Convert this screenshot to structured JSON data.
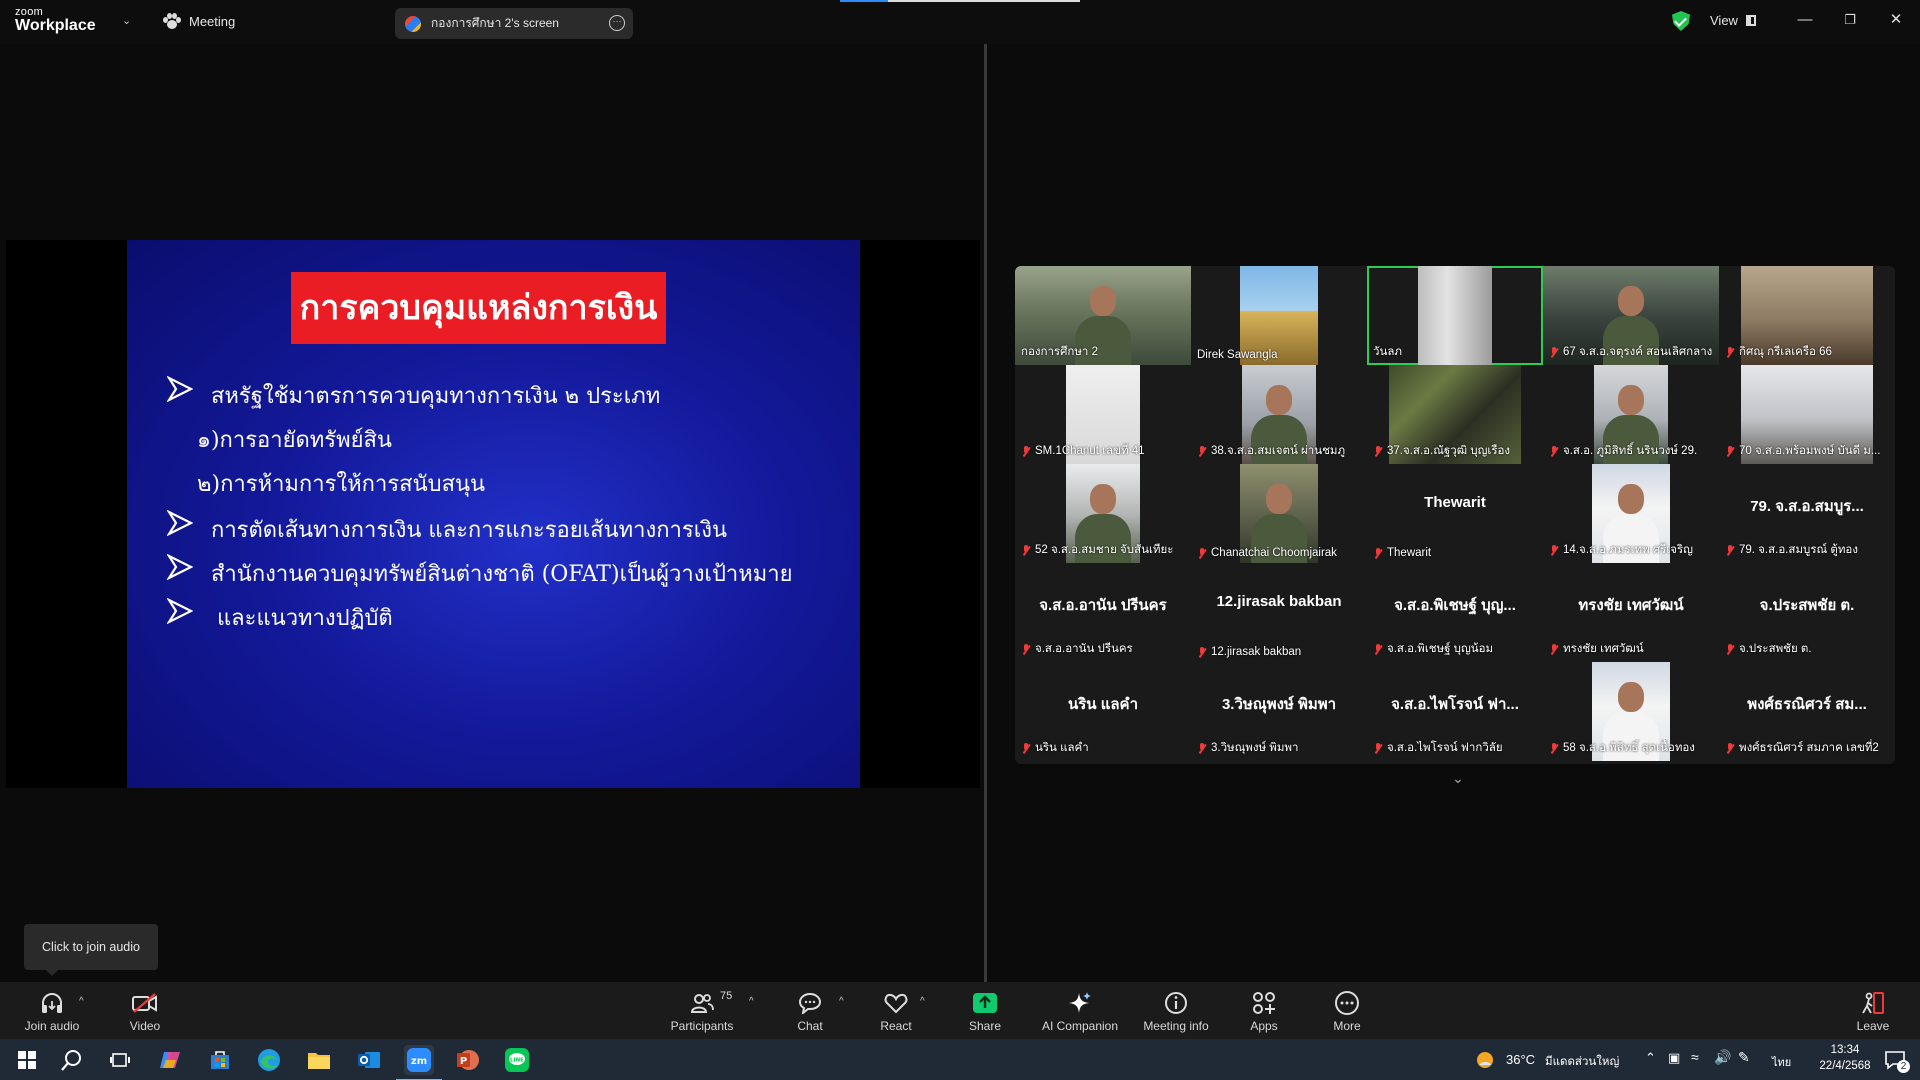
{
  "titlebar": {
    "logo_line1": "zoom",
    "logo_line2": "Workplace",
    "meeting_label": "Meeting",
    "share_pill_label": "กองการศึกษา 2's screen",
    "view_label": "View"
  },
  "slide": {
    "title": "การควบคุมแหล่งการเงิน",
    "lines": [
      "สหรัฐใช้มาตรการควบคุมทางการเงิน ๒ ประเภท",
      "๑)การอายัดทรัพย์สิน",
      "๒)การห้ามการให้การสนับสนุน",
      "การตัดเส้นทางการเงิน และการแกะรอยเส้นทางการเงิน",
      "สำนักงานควบคุมทรัพย์สินต่างชาติ (OFAT)เป็นผู้วางเป้าหมาย",
      "และแนวทางปฏิบัติ"
    ]
  },
  "gallery": {
    "tiles": [
      {
        "name": "กองการศึกษา 2",
        "big": "",
        "muted": false,
        "video": "man-green"
      },
      {
        "name": "Direk Sawangla",
        "big": "",
        "muted": false,
        "video": "painting"
      },
      {
        "name": "วันลภ",
        "big": "",
        "muted": false,
        "video": "wall",
        "active": true
      },
      {
        "name": "67 จ.ส.อ.จตุรงค์ สอนเลิศกลาง",
        "big": "",
        "muted": true,
        "video": "car-man"
      },
      {
        "name": "กิศณุ กรีเลเครือ 66",
        "big": "",
        "muted": true,
        "video": "room"
      },
      {
        "name": "SM.1Chanut เลขที่ 41",
        "big": "",
        "muted": true,
        "video": "white-wall"
      },
      {
        "name": "38.จ.ส.อ.สมเจตน์ ผ่านชมภู",
        "big": "",
        "muted": true,
        "video": "man-room"
      },
      {
        "name": "37.จ.ส.อ.ณัฐวุฒิ  บุญเรือง",
        "big": "",
        "muted": true,
        "video": "camo"
      },
      {
        "name": "จ.ส.อ. ภูมิสิทธิ์ นรินวงษ์ 29.",
        "big": "",
        "muted": true,
        "video": "man-office"
      },
      {
        "name": "70 จ.ส.อ.พร้อมพงษ์ บันดี ม...",
        "big": "",
        "muted": true,
        "video": "ceiling"
      },
      {
        "name": "52 จ.ส.อ.สมชาย  จับสันเทียะ",
        "big": "",
        "muted": true,
        "video": "man-glasses"
      },
      {
        "name": "Chanatchai Choomjairak",
        "big": "",
        "muted": true,
        "video": "man-outdoor"
      },
      {
        "name": "Thewarit",
        "big": "Thewarit",
        "muted": true,
        "video": ""
      },
      {
        "name": "14.จ.ส.อ.ภมรเทพ ศรีเจริญ",
        "big": "",
        "muted": true,
        "video": "uniform"
      },
      {
        "name": "79.  จ.ส.อ.สมบูรณ์  ตู้ทอง",
        "big": "79.  จ.ส.อ.สมบูร...",
        "muted": true,
        "video": ""
      },
      {
        "name": "จ.ส.อ.อานัน ปรีนคร",
        "big": "จ.ส.อ.อานัน ปรีนคร",
        "muted": true,
        "video": ""
      },
      {
        "name": "12.jirasak bakban",
        "big": "12.jirasak bakban",
        "muted": true,
        "video": ""
      },
      {
        "name": "จ.ส.อ.พิเชษฐ์ บุญน้อม",
        "big": "จ.ส.อ.พิเชษฐ์ บุญ...",
        "muted": true,
        "video": ""
      },
      {
        "name": "ทรงชัย   เทศวัฒน์",
        "big": "ทรงชัย   เทศวัฒน์",
        "muted": true,
        "video": ""
      },
      {
        "name": "จ.ประสพชัย ต.",
        "big": "จ.ประสพชัย ต.",
        "muted": true,
        "video": ""
      },
      {
        "name": "นริน แลคำ",
        "big": "นริน แลคำ",
        "muted": true,
        "video": ""
      },
      {
        "name": "3.วิษณุพงษ์ พิมพา",
        "big": "3.วิษณุพงษ์ พิมพา",
        "muted": true,
        "video": ""
      },
      {
        "name": "จ.ส.อ.ไพโรจน์ ฟากวิลัย",
        "big": "จ.ส.อ.ไพโรจน์ ฟา...",
        "muted": true,
        "video": ""
      },
      {
        "name": "58 จ.ส.อ.พิสิทธิ์ สุดเนื้อทอง",
        "big": "",
        "muted": true,
        "video": "uniform"
      },
      {
        "name": "พงศ์ธรณิศวร์ สมภาค เลขที่2",
        "big": "พงศ์ธรณิศวร์ สม...",
        "muted": true,
        "video": ""
      }
    ]
  },
  "toolbar": {
    "join_audio": "Join audio",
    "video": "Video",
    "participants": "Participants",
    "participants_count": "75",
    "chat": "Chat",
    "react": "React",
    "share": "Share",
    "ai_companion": "AI Companion",
    "meeting_info": "Meeting info",
    "apps": "Apps",
    "more": "More",
    "leave": "Leave",
    "tooltip": "Click to join audio"
  },
  "taskbar": {
    "weather_temp": "36°C",
    "weather_desc": "มีแดดส่วนใหญ่",
    "lang": "ไทย",
    "time": "13:34",
    "date": "22/4/2568",
    "notif_count": "2"
  },
  "colors": {
    "accent_green": "#2ecc52",
    "share_green": "#0fca6e",
    "slide_title_red": "#ea1c24",
    "slide_blue": "#13199a"
  }
}
